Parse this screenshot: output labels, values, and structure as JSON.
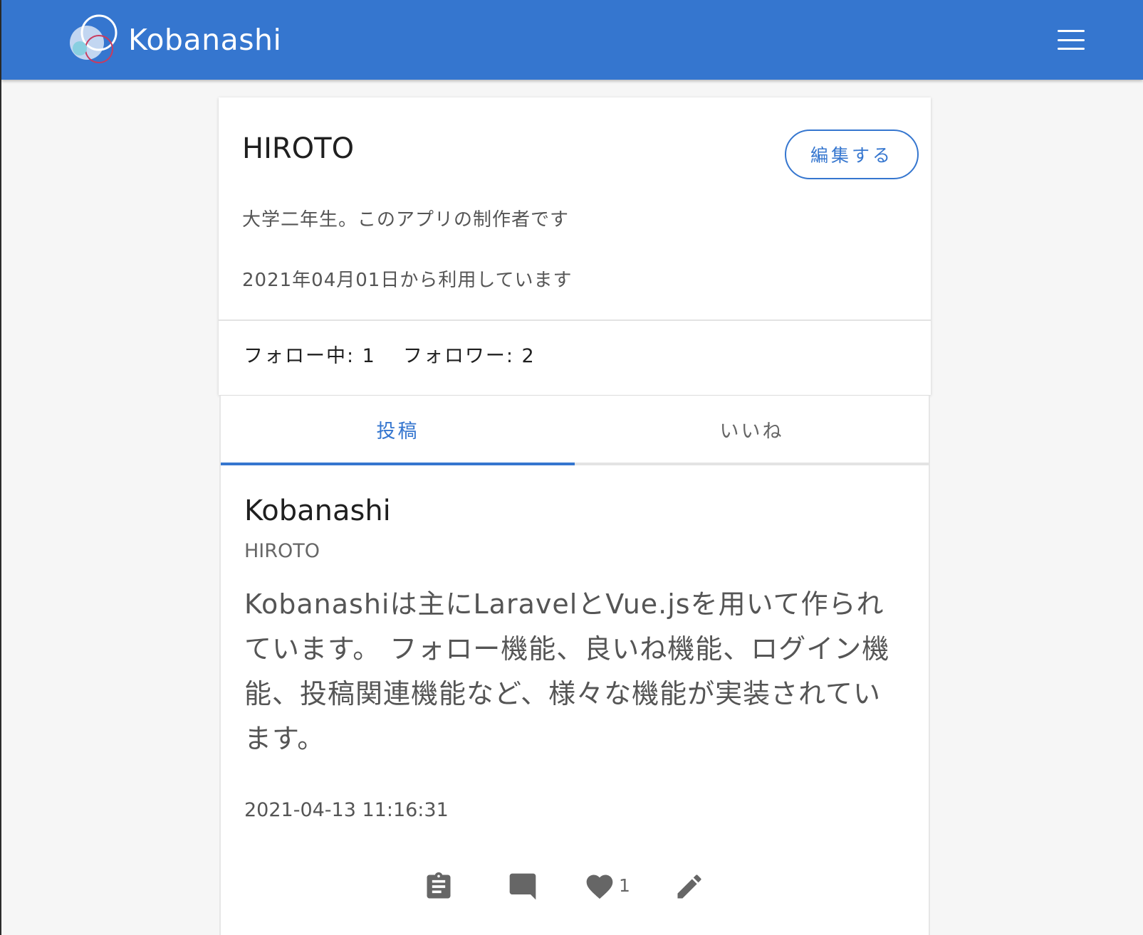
{
  "header": {
    "brand_title": "Kobanashi",
    "logo_icon": "kobanashi-logo-icon",
    "menu_icon": "hamburger-menu-icon",
    "bar_color": "#3576cf"
  },
  "profile": {
    "name": "HIROTO",
    "edit_button_label": "編集する",
    "bio": "大学二年生。このアプリの制作者です",
    "since": "2021年04月01日から利用しています",
    "following": "フォロー中: 1",
    "followers": "フォロワー: 2"
  },
  "tabs": [
    {
      "label": "投稿",
      "active": true
    },
    {
      "label": "いいね",
      "active": false
    }
  ],
  "post": {
    "title": "Kobanashi",
    "author": "HIROTO",
    "body": "Kobanashiは主にLaravelとVue.jsを用いて作られています。 フォロー機能、良いね機能、ログイン機能、投稿関連機能など、様々な機能が実装されています。",
    "date": "2021-04-13 11:16:31",
    "like_count": "1",
    "actions": [
      "clipboard-icon",
      "comment-icon",
      "heart-icon",
      "edit-icon"
    ]
  },
  "colors": {
    "accent": "#3576cf",
    "text_primary": "#1f1f1f",
    "text_secondary": "#555555",
    "icon_gray": "#666666"
  }
}
